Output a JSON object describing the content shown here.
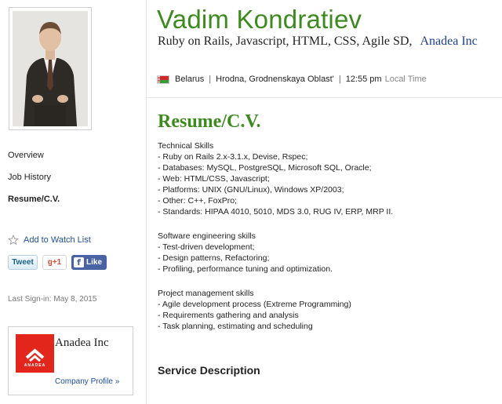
{
  "profile": {
    "name": "Vadim Kondratiev",
    "skills": "Ruby on Rails, Javascript, HTML, CSS, Agile SD,",
    "company_link": "Anadea Inc",
    "country": "Belarus",
    "city": "Hrodna, Grodnenskaya Oblast'",
    "time": "12:55 pm",
    "time_label": "Local Time",
    "photo_icon": "person-photo"
  },
  "nav": {
    "overview": "Overview",
    "job_history": "Job History",
    "resume": "Resume/C.V."
  },
  "actions": {
    "watch": "Add to Watch List",
    "tweet": "Tweet",
    "gplus": "g+1",
    "like": "Like",
    "fb_glyph": "f"
  },
  "last_signin": "Last Sign-in: May 8, 2015",
  "company": {
    "name": "Anadea Inc",
    "logo_text": "ANADEA",
    "profile_link": "Company Profile »",
    "brand_color": "#e3261c"
  },
  "resume": {
    "title": "Resume/C.V.",
    "technical": [
      "Technical Skills",
      "- Ruby on Rails 2.x-3.1.x, Devise, Rspec;",
      "- Databases: MySQL, PostgreSQL, Microsoft SQL, Oracle;",
      "- Web: HTML/CSS, Javascript;",
      "- Platforms: UNIX (GNU/Linux), Windows XP/2003;",
      "- Other: C++, FoxPro;",
      "- Standards: HIPAA 4010, 5010, MDS 3.0, RUG IV, ERP, MRP II."
    ],
    "software": [
      "Software engineering skills",
      "- Test-driven development;",
      "- Design patterns, Refactoring;",
      "- Profiling, performance tuning and optimization."
    ],
    "project": [
      "Project management skills",
      "- Agile development process (Extreme Programming)",
      "- Requirements gathering and analysis",
      "- Task planning, estimating and scheduling"
    ]
  },
  "service_description": "Service Description",
  "colors": {
    "accent_green": "#3d8a1f",
    "link_blue": "#1f4e9c"
  }
}
